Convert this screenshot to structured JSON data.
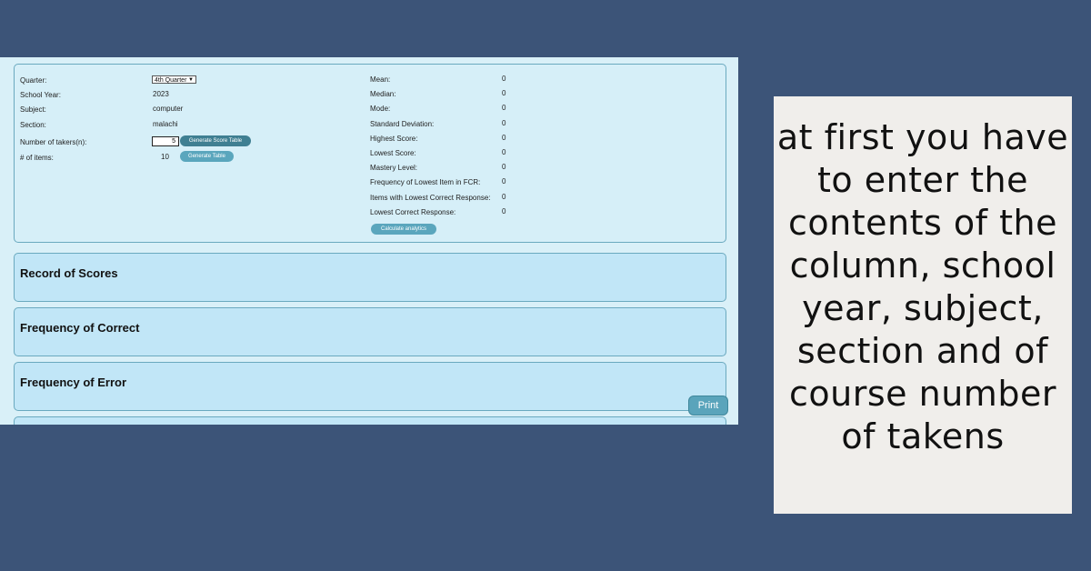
{
  "form": {
    "quarter_label": "Quarter:",
    "quarter_value": "4th Quarter",
    "school_year_label": "School Year:",
    "school_year_value": "2023",
    "subject_label": "Subject:",
    "subject_value": "computer",
    "section_label": "Section:",
    "section_value": "malachi",
    "takers_label": "Number of takers(n):",
    "takers_value": "5",
    "generate_score_table": "Generate Score Table",
    "items_label": "# of items:",
    "items_value": "10",
    "generate_table": "Generate Table"
  },
  "analytics": {
    "rows": [
      {
        "label": "Mean:",
        "value": "0"
      },
      {
        "label": "Median:",
        "value": "0"
      },
      {
        "label": "Mode:",
        "value": "0"
      },
      {
        "label": "Standard Deviation:",
        "value": "0"
      },
      {
        "label": "Highest Score:",
        "value": "0"
      },
      {
        "label": "Lowest Score:",
        "value": "0"
      },
      {
        "label": "Mastery Level:",
        "value": "0"
      },
      {
        "label": "Frequency of Lowest Item in FCR:",
        "value": "0"
      },
      {
        "label": "Items with Lowest Correct Response:",
        "value": "0"
      },
      {
        "label": "Lowest Correct Response:",
        "value": "0"
      }
    ],
    "calculate_button": "Calculate analytics"
  },
  "sections": [
    "Record of Scores",
    "Frequency of Correct",
    "Frequency of Error"
  ],
  "print_label": "Print",
  "note_text": "at first you have to enter the contents of the column, school year, subject, section and of course number of takens",
  "colors": {
    "background": "#3c5478",
    "panel": "#d9f0f8",
    "section": "#c1e6f7",
    "button": "#5aa6bd",
    "note_bg": "#f0eeeb"
  }
}
